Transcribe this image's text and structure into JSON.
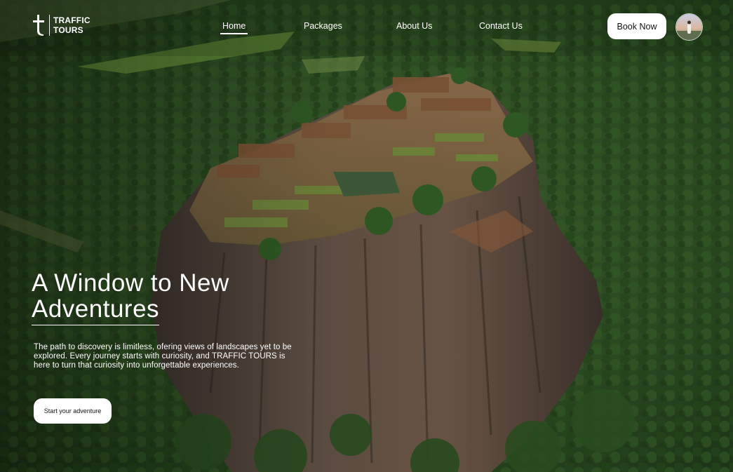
{
  "brand": {
    "line1": "TRAFFIC",
    "line2": "TOURS"
  },
  "nav": {
    "items": [
      {
        "label": "Home",
        "active": true
      },
      {
        "label": "Packages",
        "active": false
      },
      {
        "label": "About Us",
        "active": false
      },
      {
        "label": "Contact Us",
        "active": false
      }
    ],
    "book_label": "Book Now"
  },
  "hero": {
    "title_line1": "A Window to New",
    "title_line2": "Adventures",
    "description": "The path to discovery is limitless, ofering views of landscapes yet to be explored. Every journey starts with curiosity, and TRAFFIC TOURS is here to turn that curiosity into unforgettable experiences.",
    "cta_label": "Start your adventure"
  },
  "icons": {
    "logo": "t-cross-logo-icon",
    "avatar": "user-avatar-photo"
  },
  "colors": {
    "text": "#ffffff",
    "button_bg": "#ffffff",
    "button_text": "#111111",
    "forest": "#2a4a22",
    "rock": "#5a4a3c"
  }
}
